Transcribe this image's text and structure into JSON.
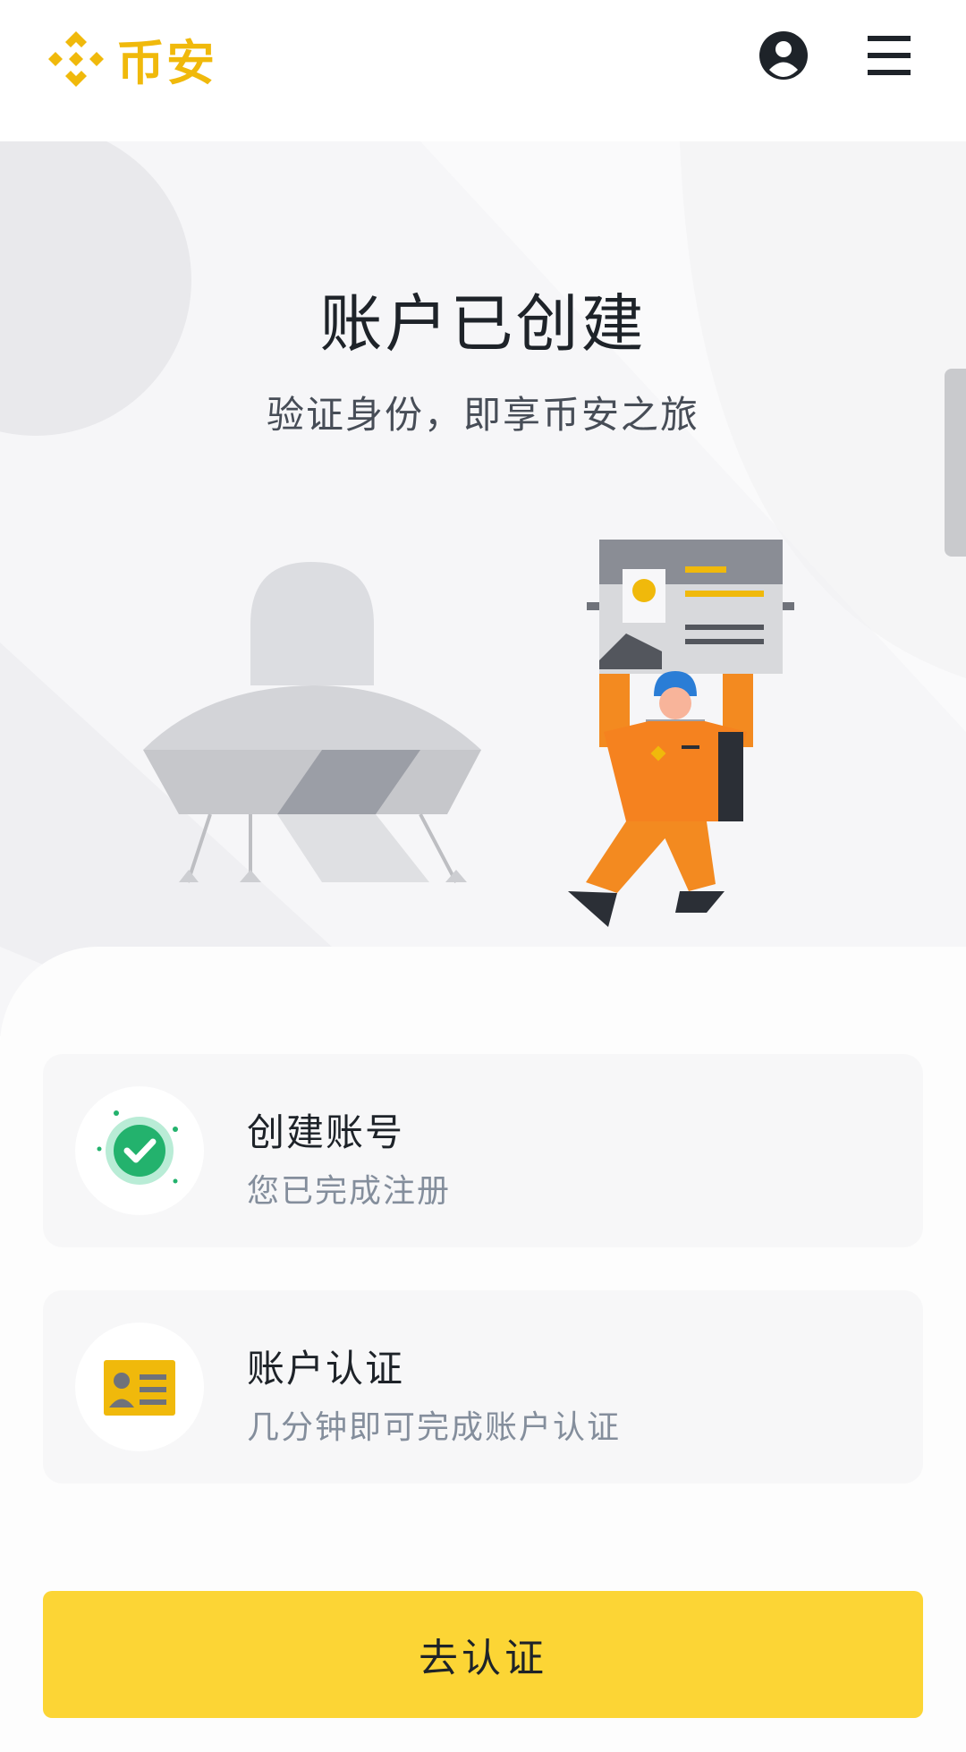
{
  "header": {
    "brand_name": "币安",
    "brand_color": "#F0B90B",
    "account_icon": "user-circle-icon",
    "menu_icon": "hamburger-menu-icon"
  },
  "hero": {
    "title": "账户已创建",
    "subtitle": "验证身份，即享币安之旅",
    "illustration": "astronaut-with-id-card-and-spaceship"
  },
  "steps": [
    {
      "title": "创建账号",
      "description": "您已完成注册",
      "icon": "check-circle-icon",
      "status": "completed",
      "status_color": "#2EBD85"
    },
    {
      "title": "账户认证",
      "description": "几分钟即可完成账户认证",
      "icon": "id-card-icon",
      "status": "pending"
    }
  ],
  "cta": {
    "label": "去认证",
    "color": "#FCD535"
  }
}
